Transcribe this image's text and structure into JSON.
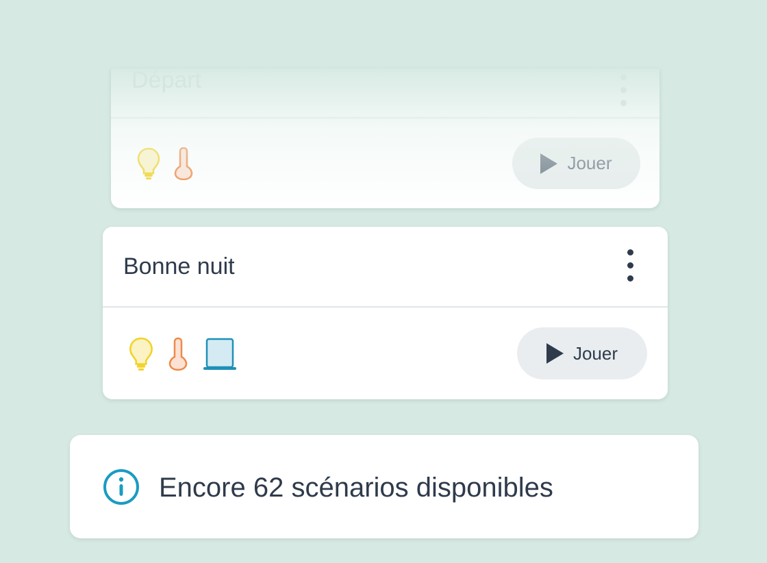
{
  "scenarios": [
    {
      "name": "Départ",
      "play_label": "Jouer",
      "icons": [
        "lightbulb-icon",
        "thermometer-icon"
      ]
    },
    {
      "name": "Bonne nuit",
      "play_label": "Jouer",
      "icons": [
        "lightbulb-icon",
        "thermometer-icon",
        "window-shutter-icon"
      ]
    }
  ],
  "info": {
    "icon": "info-icon",
    "text": "Encore 62 scénarios disponibles"
  },
  "colors": {
    "background": "#d6e9e3",
    "text": "#2f3b4b",
    "bulb": "#f2d32a",
    "thermometer": "#ee8a4a",
    "shutter": "#1e90b8",
    "info_accent": "#1a9bc2"
  }
}
